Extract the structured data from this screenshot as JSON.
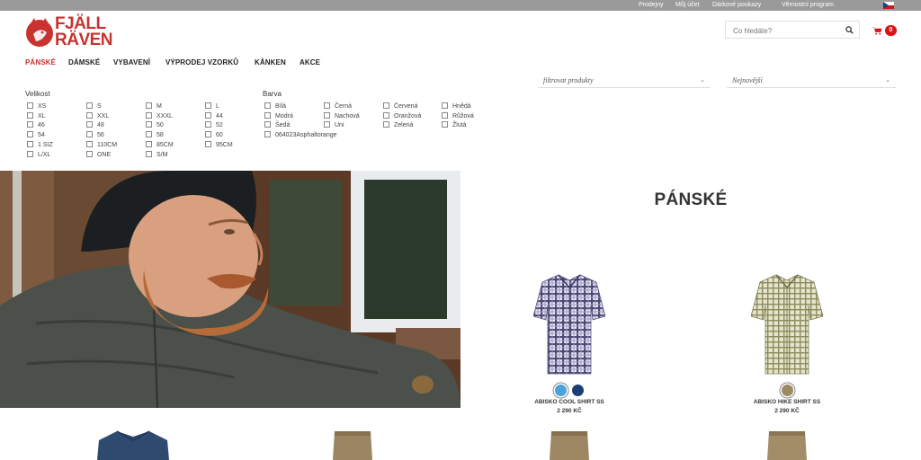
{
  "topbar": {
    "links": [
      "Prodejny",
      "Můj účet",
      "Dárkové poukazy",
      "Věrnostní program"
    ],
    "language": "CZ"
  },
  "brand": {
    "line1": "FJÄLL",
    "line2": "RÄVEN",
    "color": "#c8322f"
  },
  "search": {
    "placeholder": "Co hledáte?"
  },
  "cart": {
    "count": "0"
  },
  "nav": {
    "items": [
      "PÁNSKÉ",
      "DÁMSKÉ",
      "VYBAVENÍ",
      "VÝPRODEJ VZORKŮ",
      "KÅNKEN",
      "AKCE"
    ],
    "active": 0
  },
  "dropdowns": {
    "filter": "filtrovat produkty",
    "sort": "Nejnovější"
  },
  "filters": {
    "size_label": "Velikost",
    "sizes": [
      "XS",
      "S",
      "M",
      "L",
      "XL",
      "XXL",
      "XXXL",
      "44",
      "46",
      "48",
      "50",
      "52",
      "54",
      "56",
      "58",
      "60",
      "1 SIZ",
      "110CM",
      "85CM",
      "95CM",
      "L/XL",
      "ONE",
      "S/M"
    ],
    "color_label": "Barva",
    "colors": [
      "Bílá",
      "Černá",
      "Červená",
      "Hnědá",
      "Modrá",
      "Nachová",
      "Oranžová",
      "Růžová",
      "Šedá",
      "Uni",
      "Zelená",
      "Žlutá",
      "064023Asphaltorange"
    ]
  },
  "page": {
    "title": "PÁNSKÉ"
  },
  "products": [
    {
      "name": "ABISKO COOL SHIRT SS",
      "price": "2 290 KČ",
      "swatches": [
        "#4aa3d8",
        "#1d3e73"
      ]
    },
    {
      "name": "ABISKO HIKE SHIRT SS",
      "price": "2 290 KČ",
      "swatches": [
        "#9c8a62"
      ]
    }
  ]
}
